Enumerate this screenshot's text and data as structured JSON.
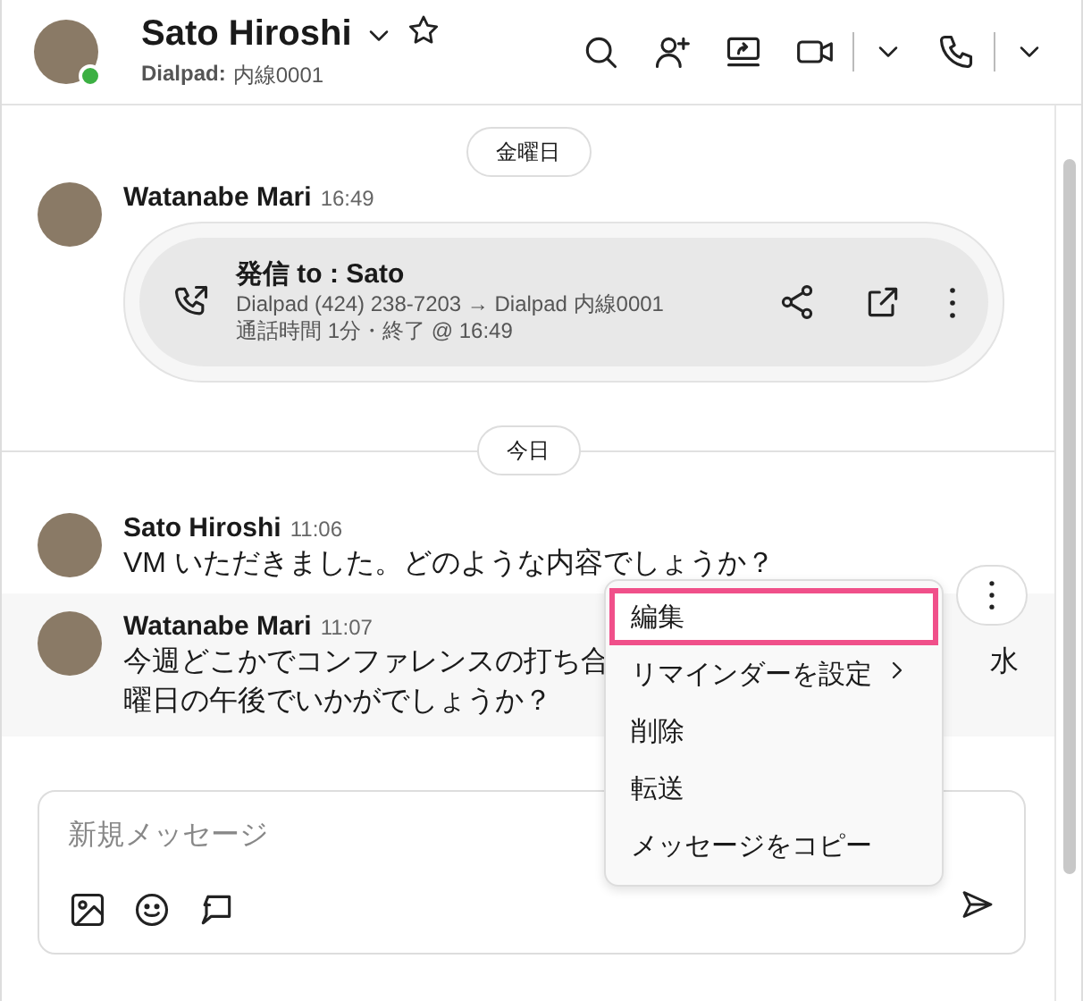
{
  "header": {
    "name": "Sato Hiroshi",
    "favorite": false,
    "subtitle_label": "Dialpad:",
    "subtitle_value": "内線0001"
  },
  "timeline": [
    {
      "kind": "date",
      "label": "金曜日",
      "divider": false
    },
    {
      "kind": "call",
      "sender": "Watanabe Mari",
      "time": "16:49",
      "title": "発信 to : Sato",
      "detail": "Dialpad (424) 238-7203 → Dialpad 内線0001",
      "duration": "通話時間 1分・終了 @ 16:49"
    },
    {
      "kind": "date",
      "label": "今日",
      "divider": true
    },
    {
      "kind": "message",
      "sender": "Sato Hiroshi",
      "time": "11:06",
      "selected": false,
      "lines": [
        [
          "VM いただきました。どのような内容でしょうか？"
        ]
      ]
    },
    {
      "kind": "message",
      "sender": "Watanabe Mari",
      "time": "11:07",
      "selected": true,
      "lines": [
        [
          "今週どこかでコンファレンスの打ち合",
          "水"
        ],
        [
          "曜日の午後でいかがでしょうか？"
        ]
      ]
    }
  ],
  "context_menu": [
    {
      "label": "編集",
      "selected": true,
      "submenu": false
    },
    {
      "label": "リマインダーを設定",
      "selected": false,
      "submenu": true
    },
    {
      "label": "削除",
      "selected": false,
      "submenu": false
    },
    {
      "label": "転送",
      "selected": false,
      "submenu": false
    },
    {
      "label": "メッセージをコピー",
      "selected": false,
      "submenu": false
    }
  ],
  "composer": {
    "placeholder": "新規メッセージ"
  }
}
